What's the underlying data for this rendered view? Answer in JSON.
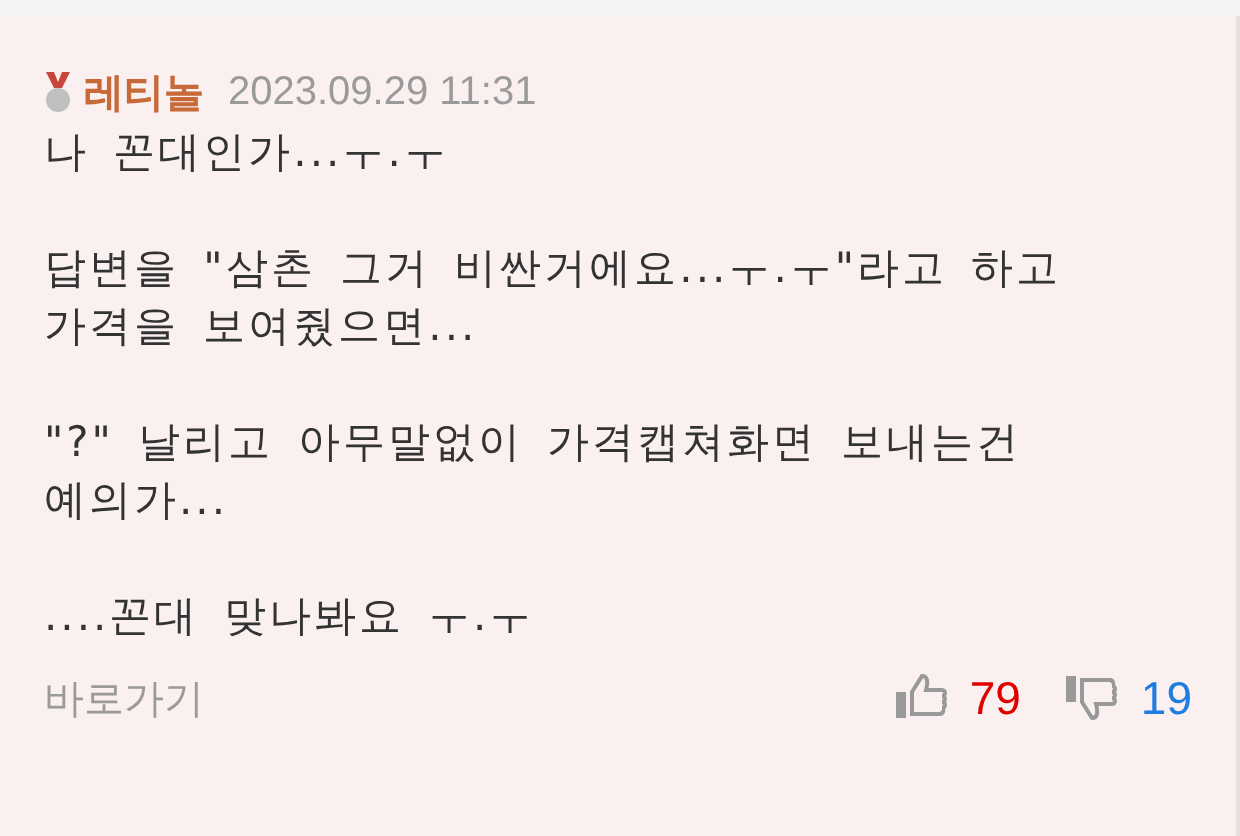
{
  "comment": {
    "author": "레티놀",
    "date": "2023.09.29 11:31",
    "paragraphs": [
      {
        "lines": [
          "나 꼰대인가...ㅜ.ㅜ"
        ]
      },
      {
        "lines": [
          "답변을 \"삼촌 그거 비싼거에요...ㅜ.ㅜ\"라고 하고",
          "가격을 보여줬으면..."
        ]
      },
      {
        "lines": [
          "\"?\" 날리고 아무말없이 가격캡쳐화면 보내는건",
          "예의가..."
        ]
      },
      {
        "lines": [
          "....꼰대 맞나봐요 ㅜ.ㅜ"
        ]
      }
    ],
    "link": "바로가기",
    "likes": "79",
    "dislikes": "19"
  }
}
